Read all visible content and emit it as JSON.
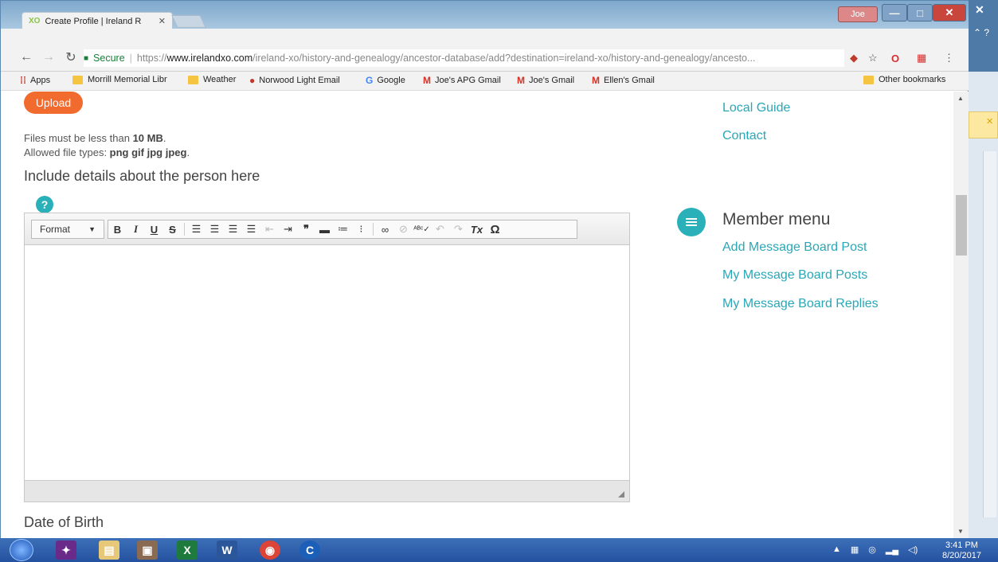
{
  "browser": {
    "tab_title": "Create Profile | Ireland R",
    "tab_favicon": "XO",
    "user": "Joe",
    "address": {
      "secure_label": "Secure",
      "scheme": "https://",
      "host": "www.irelandxo.com",
      "path": "/ireland-xo/history-and-genealogy/ancestor-database/add?destination=ireland-xo/history-and-genealogy/ancesto..."
    },
    "bookmarks": [
      {
        "label": "Apps",
        "icon": "apps-grid-icon"
      },
      {
        "label": "Morrill Memorial Libr",
        "icon": "folder-icon"
      },
      {
        "label": "Weather",
        "icon": "folder-icon"
      },
      {
        "label": "Norwood Light Email",
        "icon": "norwood-icon"
      },
      {
        "label": "Google",
        "icon": "google-icon"
      },
      {
        "label": "Joe's APG Gmail",
        "icon": "gmail-icon"
      },
      {
        "label": "Joe's Gmail",
        "icon": "gmail-icon"
      },
      {
        "label": "Ellen's Gmail",
        "icon": "gmail-icon"
      }
    ],
    "other_bookmarks": "Other bookmarks"
  },
  "form": {
    "upload_label": "Upload",
    "file_limit_prefix": "Files must be less than ",
    "file_limit_value": "10 MB",
    "file_limit_suffix": ".",
    "file_types_prefix": "Allowed file types: ",
    "file_types_value": "png gif jpg jpeg",
    "file_types_suffix": ".",
    "details_title": "Include details about the person here",
    "help_icon_glyph": "?",
    "editor": {
      "format_label": "Format",
      "body_text": ""
    },
    "dob_label": "Date of Birth"
  },
  "sidebar": {
    "top_links": [
      "Local Guide",
      "Contact"
    ],
    "member_menu_title": "Member menu",
    "member_links": [
      "Add Message Board Post",
      "My Message Board Posts",
      "My Message Board Replies"
    ]
  },
  "taskbar": {
    "time": "3:41 PM",
    "date": "8/20/2017"
  },
  "colors": {
    "accent_teal": "#2ab0b8",
    "upload_orange": "#f26b2e",
    "link_teal": "#2aa7b6"
  }
}
